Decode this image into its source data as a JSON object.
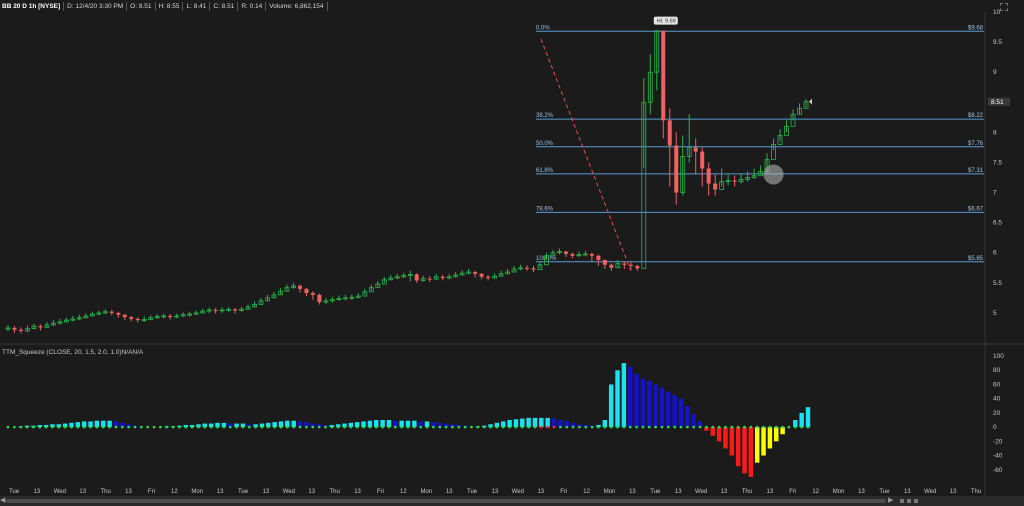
{
  "header": {
    "symbol": "BB 20 D 1h [NYSE]",
    "date": "D: 12/4/20 3:30 PM",
    "open": "O: 8.51",
    "high": "H: 8.55",
    "low": "L: 8.41",
    "close": "C: 8.51",
    "range": "R: 0.14",
    "volume": "Volume: 6,862,154"
  },
  "colors": {
    "background": "#1b1b1b",
    "up_candle": "#2bb34a",
    "down_candle": "#f06161",
    "fib_line": "#5b9bd5",
    "trend_line": "#e0524f",
    "hist_cyan": "#17e4f0",
    "hist_blue": "#1313c9",
    "hist_red": "#ff1a1a",
    "hist_yellow": "#ffff00",
    "dot_green": "#2ed94a",
    "dot_red": "#ff2a2a"
  },
  "chart_data": [
    {
      "type": "candlestick",
      "title": "BB 20 D 1h [NYSE]",
      "ylim": [
        4.5,
        10
      ],
      "y_ticks": [
        10,
        9.5,
        9,
        8.5,
        8,
        7.5,
        7,
        6.5,
        6,
        5.5,
        5
      ],
      "last_price_label": "8.51",
      "high_callout": "Hi: 9.69",
      "fib_levels": [
        {
          "label": "0.0%",
          "price": 9.68,
          "value_label": "$9.68"
        },
        {
          "label": "38.2%",
          "price": 8.22,
          "value_label": "$8.22"
        },
        {
          "label": "50.0%",
          "price": 7.76,
          "value_label": "$7.76"
        },
        {
          "label": "61.8%",
          "price": 7.31,
          "value_label": "$7.31"
        },
        {
          "label": "78.6%",
          "price": 6.67,
          "value_label": "$6.67"
        },
        {
          "label": "100.0%",
          "price": 5.85,
          "value_label": "$5.85"
        }
      ],
      "closes": [
        4.75,
        4.72,
        4.7,
        4.74,
        4.78,
        4.76,
        4.8,
        4.83,
        4.85,
        4.88,
        4.9,
        4.92,
        4.95,
        4.98,
        5.0,
        5.02,
        5.0,
        4.97,
        4.93,
        4.9,
        4.88,
        4.89,
        4.92,
        4.94,
        4.95,
        4.93,
        4.95,
        4.97,
        4.98,
        5.0,
        5.03,
        5.05,
        5.04,
        5.05,
        5.06,
        5.04,
        5.06,
        5.1,
        5.14,
        5.2,
        5.25,
        5.3,
        5.36,
        5.42,
        5.45,
        5.4,
        5.33,
        5.3,
        5.18,
        5.2,
        5.22,
        5.24,
        5.25,
        5.26,
        5.28,
        5.35,
        5.42,
        5.48,
        5.55,
        5.58,
        5.6,
        5.62,
        5.64,
        5.54,
        5.57,
        5.56,
        5.6,
        5.58,
        5.6,
        5.63,
        5.66,
        5.68,
        5.65,
        5.6,
        5.58,
        5.61,
        5.65,
        5.68,
        5.73,
        5.75,
        5.74,
        5.72,
        5.8,
        5.95,
        6.0,
        6.02,
        5.98,
        5.95,
        5.97,
        5.98,
        5.95,
        5.88,
        5.8,
        5.75,
        5.82,
        5.8,
        5.78,
        5.74,
        8.5,
        9.0,
        9.69,
        8.2,
        7.78,
        7.0,
        7.6,
        7.75,
        7.68,
        7.4,
        7.15,
        7.05,
        7.18,
        7.2,
        7.18,
        7.22,
        7.25,
        7.28,
        7.35,
        7.55,
        7.8,
        7.95,
        8.1,
        8.3,
        8.4,
        8.51
      ],
      "highs": [
        4.8,
        4.78,
        4.76,
        4.79,
        4.82,
        4.81,
        4.85,
        4.88,
        4.9,
        4.92,
        4.95,
        4.97,
        4.99,
        5.02,
        5.04,
        5.06,
        5.05,
        5.02,
        4.98,
        4.95,
        4.93,
        4.94,
        4.96,
        4.98,
        4.99,
        4.98,
        4.99,
        5.01,
        5.02,
        5.04,
        5.07,
        5.09,
        5.08,
        5.09,
        5.1,
        5.08,
        5.1,
        5.14,
        5.19,
        5.25,
        5.3,
        5.35,
        5.41,
        5.47,
        5.5,
        5.47,
        5.41,
        5.36,
        5.32,
        5.25,
        5.27,
        5.29,
        5.3,
        5.31,
        5.33,
        5.4,
        5.47,
        5.53,
        5.6,
        5.63,
        5.65,
        5.67,
        5.7,
        5.66,
        5.62,
        5.61,
        5.65,
        5.63,
        5.65,
        5.68,
        5.71,
        5.73,
        5.7,
        5.66,
        5.63,
        5.66,
        5.7,
        5.73,
        5.78,
        5.8,
        5.79,
        5.78,
        5.86,
        6.0,
        6.05,
        6.07,
        6.03,
        6.0,
        6.02,
        6.03,
        6.0,
        5.97,
        5.88,
        5.82,
        5.88,
        5.85,
        5.84,
        5.8,
        8.9,
        9.3,
        9.69,
        9.2,
        8.4,
        8.0,
        7.95,
        8.3,
        7.9,
        7.75,
        7.5,
        7.3,
        7.4,
        7.3,
        7.28,
        7.3,
        7.35,
        7.4,
        7.45,
        7.65,
        7.9,
        8.05,
        8.2,
        8.38,
        8.48,
        8.55
      ],
      "lows": [
        4.7,
        4.67,
        4.66,
        4.68,
        4.73,
        4.71,
        4.75,
        4.78,
        4.81,
        4.84,
        4.86,
        4.88,
        4.91,
        4.94,
        4.96,
        4.98,
        4.96,
        4.92,
        4.88,
        4.86,
        4.84,
        4.85,
        4.88,
        4.9,
        4.91,
        4.89,
        4.91,
        4.93,
        4.94,
        4.96,
        4.99,
        5.0,
        4.99,
        5.0,
        5.02,
        4.99,
        5.02,
        5.06,
        5.1,
        5.15,
        5.21,
        5.26,
        5.31,
        5.37,
        5.4,
        5.34,
        5.28,
        5.22,
        5.14,
        5.15,
        5.17,
        5.2,
        5.21,
        5.22,
        5.24,
        5.3,
        5.37,
        5.44,
        5.5,
        5.54,
        5.56,
        5.58,
        5.52,
        5.5,
        5.52,
        5.51,
        5.55,
        5.54,
        5.56,
        5.59,
        5.62,
        5.64,
        5.59,
        5.56,
        5.54,
        5.57,
        5.61,
        5.64,
        5.69,
        5.71,
        5.7,
        5.68,
        5.74,
        5.88,
        5.96,
        5.97,
        5.93,
        5.91,
        5.93,
        5.94,
        5.86,
        5.78,
        5.73,
        5.7,
        5.76,
        5.73,
        5.72,
        5.7,
        7.4,
        8.3,
        8.7,
        7.9,
        7.1,
        6.8,
        6.95,
        7.5,
        7.3,
        7.1,
        6.95,
        6.95,
        7.1,
        7.12,
        7.1,
        7.15,
        7.18,
        7.22,
        7.3,
        7.35,
        7.7,
        7.85,
        8.0,
        8.2,
        8.3,
        8.41
      ],
      "x_tick_labels": [
        "Tue",
        "13",
        "Wed",
        "13",
        "Thu",
        "13",
        "Fri",
        "12",
        "Mon",
        "13",
        "Tue",
        "13",
        "Wed",
        "13",
        "Thu",
        "13",
        "Fri",
        "12",
        "Mon",
        "13",
        "Tue",
        "13",
        "Wed",
        "13",
        "Fri",
        "12",
        "Mon",
        "13",
        "Tue",
        "13",
        "Wed",
        "13",
        "Thu",
        "13",
        "Fri",
        "12",
        "Mon",
        "13",
        "Tue",
        "13",
        "Wed",
        "13",
        "Thu"
      ]
    },
    {
      "type": "bar",
      "title": "TTM_Squeeze (CLOSE, 20, 1.5, 2.0, 1.0)N/AN/A",
      "ylim": [
        -80,
        100
      ],
      "y_ticks": [
        100,
        80,
        60,
        40,
        20,
        0,
        -20,
        -40,
        -60
      ],
      "values": [
        0,
        0,
        1,
        2,
        2,
        3,
        3,
        4,
        4,
        5,
        6,
        7,
        8,
        8,
        9,
        9,
        9,
        8,
        6,
        4,
        2,
        1,
        0,
        0,
        0,
        1,
        1,
        2,
        3,
        3,
        4,
        5,
        5,
        6,
        6,
        5,
        5,
        5,
        4,
        4,
        5,
        6,
        7,
        8,
        9,
        9,
        8,
        7,
        5,
        4,
        3,
        3,
        4,
        5,
        6,
        7,
        8,
        9,
        10,
        10,
        10,
        9,
        9,
        9,
        9,
        8,
        8,
        7,
        6,
        5,
        4,
        3,
        2,
        1,
        1,
        2,
        4,
        6,
        8,
        10,
        11,
        12,
        13,
        13,
        13,
        13,
        12,
        10,
        8,
        6,
        4,
        3,
        2,
        3,
        10,
        60,
        80,
        90,
        85,
        75,
        68,
        65,
        60,
        55,
        50,
        45,
        40,
        30,
        18,
        8,
        -5,
        -12,
        -20,
        -30,
        -40,
        -55,
        -65,
        -70,
        -50,
        -40,
        -30,
        -20,
        -10,
        0,
        10,
        20,
        28
      ],
      "squeeze_dots": "green"
    }
  ]
}
